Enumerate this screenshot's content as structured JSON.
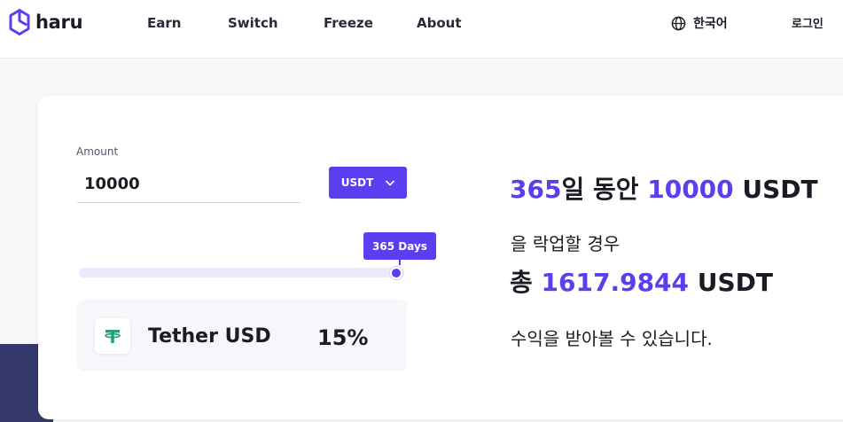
{
  "brand": {
    "name": "haru",
    "accent": "#5a3ff0",
    "dark": "#1b1b25"
  },
  "nav": {
    "items": [
      {
        "label": "Earn"
      },
      {
        "label": "Switch"
      },
      {
        "label": "Freeze"
      },
      {
        "label": "About"
      }
    ],
    "language": {
      "label": "한국어",
      "icon": "globe-icon"
    },
    "login_label": "로그인"
  },
  "calculator": {
    "amount_label": "Amount",
    "amount_value": "10000",
    "currency": "USDT",
    "currency_icon": "chevron-down-icon",
    "period_tooltip": "365 Days",
    "period_fraction": 1.0,
    "token": {
      "name": "Tether USD",
      "rate": "15%",
      "icon": "tether-icon"
    }
  },
  "result": {
    "days": "365",
    "days_suffix": "일 동안 ",
    "amount": "10000",
    "currency": " USDT",
    "line2": "을 락업할 경우",
    "total_prefix": "총 ",
    "total": "1617.9844",
    "total_currency": " USDT",
    "line4": "수익을 받아볼 수 있습니다."
  }
}
